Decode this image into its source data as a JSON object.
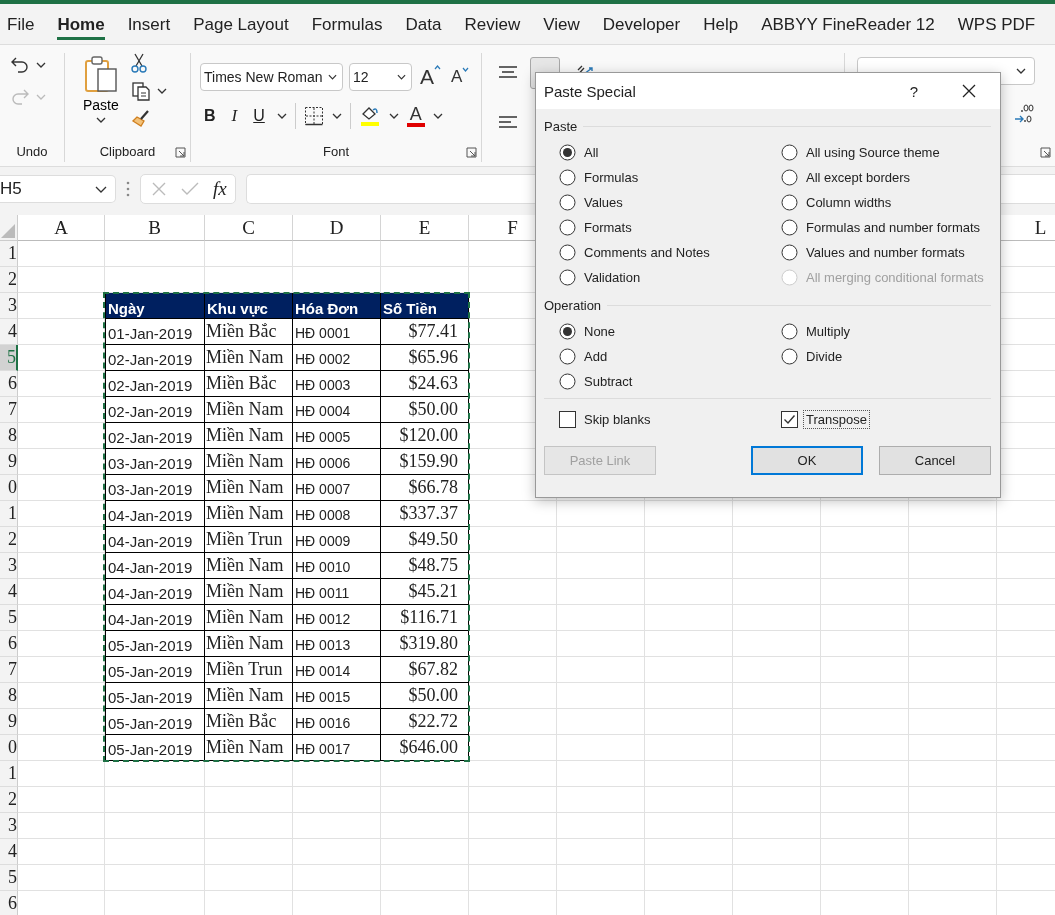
{
  "tabs": [
    {
      "label": "File",
      "selected": false
    },
    {
      "label": "Home",
      "selected": true
    },
    {
      "label": "Insert",
      "selected": false
    },
    {
      "label": "Page Layout",
      "selected": false
    },
    {
      "label": "Formulas",
      "selected": false
    },
    {
      "label": "Data",
      "selected": false
    },
    {
      "label": "Review",
      "selected": false
    },
    {
      "label": "View",
      "selected": false
    },
    {
      "label": "Developer",
      "selected": false
    },
    {
      "label": "Help",
      "selected": false
    },
    {
      "label": "ABBYY FineReader 12",
      "selected": false
    },
    {
      "label": "WPS PDF",
      "selected": false
    }
  ],
  "ribbon": {
    "undo_label": "Undo",
    "redo_disabled": true,
    "clipboard_label": "Clipboard",
    "paste_label": "Paste",
    "font_label": "Font",
    "font_name": "Times New Roman",
    "font_size": "12",
    "grow_font": "A",
    "shrink_font": "A",
    "bold": "B",
    "italic": "I",
    "underline": "U",
    "font_color_glyph": "A",
    "middle_align_pressed": true
  },
  "formula_bar": {
    "name_box": "H5",
    "function_label": "fx"
  },
  "sheet": {
    "columns": [
      "A",
      "B",
      "C",
      "D",
      "E",
      "F",
      "L"
    ],
    "rows": [
      {
        "header": "1",
        "selected": false
      },
      {
        "header": "2",
        "selected": false
      },
      {
        "header": "3",
        "selected": false,
        "kind": "header",
        "cells": [
          "Ngày",
          "Khu vực",
          "Hóa Đơn",
          "Số Tiền"
        ]
      },
      {
        "header": "4",
        "selected": false,
        "kind": "data",
        "cells": [
          "01-Jan-2019",
          "Miền Bắc",
          "HĐ 0001",
          "$77.41"
        ]
      },
      {
        "header": "5",
        "selected": true,
        "kind": "data",
        "cells": [
          "02-Jan-2019",
          "Miền Nam",
          "HĐ 0002",
          "$65.96"
        ]
      },
      {
        "header": "6",
        "selected": false,
        "kind": "data",
        "cells": [
          "02-Jan-2019",
          "Miền Bắc",
          "HĐ 0003",
          "$24.63"
        ]
      },
      {
        "header": "7",
        "selected": false,
        "kind": "data",
        "cells": [
          "02-Jan-2019",
          "Miền Nam",
          "HĐ 0004",
          "$50.00"
        ]
      },
      {
        "header": "8",
        "selected": false,
        "kind": "data",
        "cells": [
          "02-Jan-2019",
          "Miền Nam",
          "HĐ 0005",
          "$120.00"
        ]
      },
      {
        "header": "9",
        "selected": false,
        "kind": "data",
        "cells": [
          "03-Jan-2019",
          "Miền Nam",
          "HĐ 0006",
          "$159.90"
        ]
      },
      {
        "header": "0",
        "selected": false,
        "kind": "data",
        "cells": [
          "03-Jan-2019",
          "Miền Nam",
          "HĐ 0007",
          "$66.78"
        ]
      },
      {
        "header": "1",
        "selected": false,
        "kind": "data",
        "cells": [
          "04-Jan-2019",
          "Miền Nam",
          "HĐ 0008",
          "$337.37"
        ]
      },
      {
        "header": "2",
        "selected": false,
        "kind": "data",
        "cells": [
          "04-Jan-2019",
          "Miền Trun",
          "HĐ 0009",
          "$49.50"
        ]
      },
      {
        "header": "3",
        "selected": false,
        "kind": "data",
        "cells": [
          "04-Jan-2019",
          "Miền Nam",
          "HĐ 0010",
          "$48.75"
        ]
      },
      {
        "header": "4",
        "selected": false,
        "kind": "data",
        "cells": [
          "04-Jan-2019",
          "Miền Nam",
          "HĐ 0011",
          "$45.21"
        ]
      },
      {
        "header": "5",
        "selected": false,
        "kind": "data",
        "cells": [
          "04-Jan-2019",
          "Miền Nam",
          "HĐ 0012",
          "$116.71"
        ]
      },
      {
        "header": "6",
        "selected": false,
        "kind": "data",
        "cells": [
          "05-Jan-2019",
          "Miền Nam",
          "HĐ 0013",
          "$319.80"
        ]
      },
      {
        "header": "7",
        "selected": false,
        "kind": "data",
        "cells": [
          "05-Jan-2019",
          "Miền Trun",
          "HĐ 0014",
          "$67.82"
        ]
      },
      {
        "header": "8",
        "selected": false,
        "kind": "data",
        "cells": [
          "05-Jan-2019",
          "Miền Nam",
          "HĐ 0015",
          "$50.00"
        ]
      },
      {
        "header": "9",
        "selected": false,
        "kind": "data",
        "cells": [
          "05-Jan-2019",
          "Miền Bắc",
          "HĐ 0016",
          "$22.72"
        ]
      },
      {
        "header": "0",
        "selected": false,
        "kind": "data",
        "cells": [
          "05-Jan-2019",
          "Miền Nam",
          "HĐ 0017",
          "$646.00"
        ]
      },
      {
        "header": "1",
        "selected": false
      },
      {
        "header": "2",
        "selected": false
      },
      {
        "header": "3",
        "selected": false
      },
      {
        "header": "4",
        "selected": false
      },
      {
        "header": "5",
        "selected": false
      },
      {
        "header": "6",
        "selected": false
      }
    ]
  },
  "dialog": {
    "title": "Paste Special",
    "help": "?",
    "paste_heading": "Paste",
    "paste_options": [
      {
        "label": "All",
        "selected": true,
        "disabled": false
      },
      {
        "label": "All using Source theme",
        "selected": false,
        "disabled": false
      },
      {
        "label": "Formulas",
        "selected": false,
        "disabled": false
      },
      {
        "label": "All except borders",
        "selected": false,
        "disabled": false
      },
      {
        "label": "Values",
        "selected": false,
        "disabled": false
      },
      {
        "label": "Column widths",
        "selected": false,
        "disabled": false
      },
      {
        "label": "Formats",
        "selected": false,
        "disabled": false
      },
      {
        "label": "Formulas and number formats",
        "selected": false,
        "disabled": false
      },
      {
        "label": "Comments and Notes",
        "selected": false,
        "disabled": false
      },
      {
        "label": "Values and number formats",
        "selected": false,
        "disabled": false
      },
      {
        "label": "Validation",
        "selected": false,
        "disabled": false
      },
      {
        "label": "All merging conditional formats",
        "selected": false,
        "disabled": true
      }
    ],
    "operation_heading": "Operation",
    "operations": [
      {
        "label": "None",
        "selected": true
      },
      {
        "label": "Multiply",
        "selected": false
      },
      {
        "label": "Add",
        "selected": false
      },
      {
        "label": "Divide",
        "selected": false
      },
      {
        "label": "Subtract",
        "selected": false
      }
    ],
    "checkboxes": [
      {
        "label": "Skip blanks",
        "checked": false,
        "focused": false
      },
      {
        "label": "Transpose",
        "checked": true,
        "focused": true
      }
    ],
    "buttons": [
      {
        "label": "Paste Link",
        "disabled": true,
        "default": false
      },
      {
        "label": "OK",
        "disabled": false,
        "default": true
      },
      {
        "label": "Cancel",
        "disabled": false,
        "default": false
      }
    ]
  }
}
